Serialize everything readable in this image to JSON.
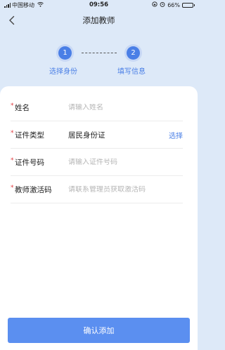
{
  "status_bar": {
    "carrier": "中国移动",
    "time": "09:56",
    "battery_text": "66%",
    "battery_level": 0.66
  },
  "nav": {
    "title": "添加教师"
  },
  "stepper": {
    "steps": [
      {
        "number": "1",
        "label": "选择身份"
      },
      {
        "number": "2",
        "label": "填写信息"
      }
    ]
  },
  "form": {
    "required_mark": "*",
    "name": {
      "label": "姓名",
      "placeholder": "请输入姓名"
    },
    "id_type": {
      "label": "证件类型",
      "value": "居民身份证",
      "action": "选择"
    },
    "id_number": {
      "label": "证件号码",
      "placeholder": "请输入证件号码"
    },
    "activation_code": {
      "label": "教师激活码",
      "placeholder": "请联系管理员获取激活码"
    }
  },
  "confirm_label": "确认添加",
  "colors": {
    "accent": "#4a7fe6",
    "button": "#5b8ff0",
    "background": "#dde9f8",
    "required": "#e0393e"
  }
}
